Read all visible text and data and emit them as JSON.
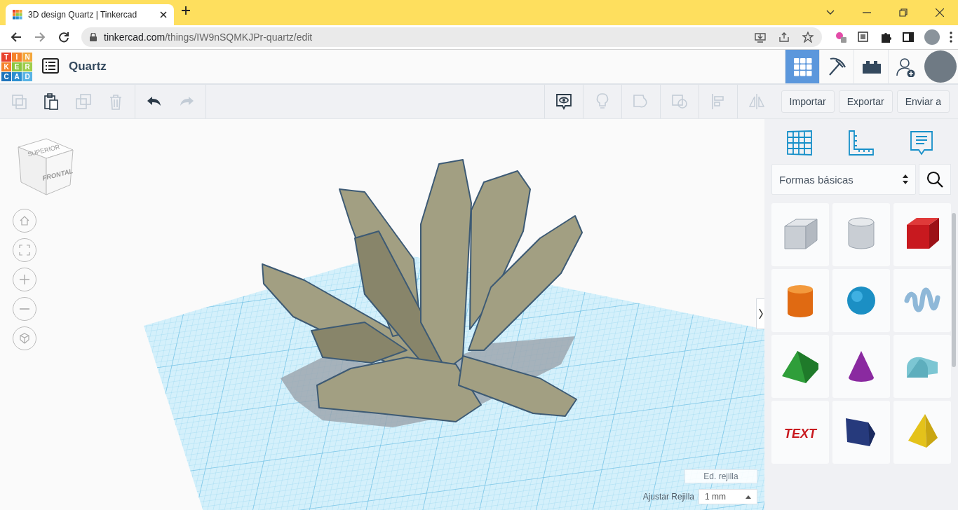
{
  "browser": {
    "tab": {
      "title": "3D design Quartz | Tinkercad",
      "selected": true
    },
    "url": {
      "host": "tinkercad.com",
      "path": "/things/IW9nSQMKJPr-quartz/edit"
    }
  },
  "app": {
    "logo": [
      {
        "letter": "T",
        "color": "#e8412c"
      },
      {
        "letter": "I",
        "color": "#f5822a"
      },
      {
        "letter": "N",
        "color": "#f3a63b"
      },
      {
        "letter": "K",
        "color": "#f5822a"
      },
      {
        "letter": "E",
        "color": "#8cc63f"
      },
      {
        "letter": "R",
        "color": "#9fcd4a"
      },
      {
        "letter": "C",
        "color": "#1f74bb"
      },
      {
        "letter": "A",
        "color": "#2b8fd0"
      },
      {
        "letter": "D",
        "color": "#58b3e4"
      }
    ],
    "title": "Quartz",
    "modes": [
      {
        "kind": "grid",
        "selected": true
      },
      {
        "kind": "pickaxe",
        "selected": false
      },
      {
        "kind": "bricks",
        "selected": false
      },
      {
        "kind": "user-add",
        "selected": false
      }
    ]
  },
  "toolbar": {
    "edit_tools": [
      {
        "kind": "copy",
        "disabled": true
      },
      {
        "kind": "paste",
        "disabled": false
      },
      {
        "kind": "duplicate",
        "disabled": true
      },
      {
        "kind": "delete",
        "disabled": true
      },
      {
        "kind": "undo",
        "disabled": false
      },
      {
        "kind": "redo",
        "disabled": true
      }
    ],
    "shape_tools": [
      {
        "kind": "notes",
        "disabled": false
      },
      {
        "kind": "bulb",
        "disabled": true
      },
      {
        "kind": "group",
        "disabled": true
      },
      {
        "kind": "ungroup",
        "disabled": true
      },
      {
        "kind": "align",
        "disabled": true
      },
      {
        "kind": "mirror",
        "disabled": true
      }
    ],
    "buttons": [
      "Importar",
      "Exportar",
      "Enviar a"
    ]
  },
  "view_cube": {
    "top": "SUPERIOR",
    "front": "FRONTAL"
  },
  "grid_controls": {
    "edit_button": "Ed. rejilla",
    "snap_label": "Ajustar Rejilla",
    "snap_value": "1 mm"
  },
  "panel": {
    "tools": [
      {
        "kind": "workplane"
      },
      {
        "kind": "ruler"
      },
      {
        "kind": "notes"
      }
    ],
    "category": "Formas básicas",
    "shapes": [
      {
        "kind": "box-hole"
      },
      {
        "kind": "cylinder-hole"
      },
      {
        "kind": "box"
      },
      {
        "kind": "cylinder"
      },
      {
        "kind": "sphere"
      },
      {
        "kind": "scribble"
      },
      {
        "kind": "roof"
      },
      {
        "kind": "cone"
      },
      {
        "kind": "round-roof"
      },
      {
        "kind": "text",
        "label": "TEXT"
      },
      {
        "kind": "wedge"
      },
      {
        "kind": "pyramid"
      }
    ]
  }
}
